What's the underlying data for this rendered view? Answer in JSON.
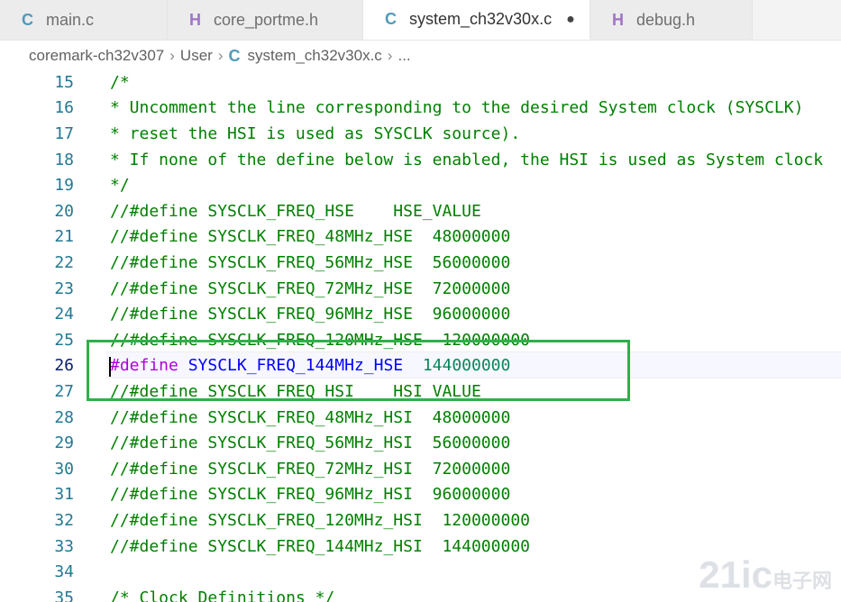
{
  "tabs": [
    {
      "icon": "C",
      "label": "main.c",
      "active": false,
      "modified": false
    },
    {
      "icon": "H",
      "label": "core_portme.h",
      "active": false,
      "modified": false
    },
    {
      "icon": "C",
      "label": "system_ch32v30x.c",
      "active": true,
      "modified": true
    },
    {
      "icon": "H",
      "label": "debug.h",
      "active": false,
      "modified": false
    }
  ],
  "breadcrumb": {
    "project": "coremark-ch32v307",
    "folder": "User",
    "file_icon": "C",
    "file": "system_ch32v30x.c",
    "more": "..."
  },
  "editor": {
    "current_line": 26,
    "lines": [
      {
        "n": "15",
        "text": "/*"
      },
      {
        "n": "16",
        "text": "* Uncomment the line corresponding to the desired System clock (SYSCLK)"
      },
      {
        "n": "17",
        "text": "* reset the HSI is used as SYSCLK source)."
      },
      {
        "n": "18",
        "text": "* If none of the define below is enabled, the HSI is used as System clock"
      },
      {
        "n": "19",
        "text": "*/"
      },
      {
        "n": "20",
        "text": "//#define SYSCLK_FREQ_HSE    HSE_VALUE"
      },
      {
        "n": "21",
        "text": "//#define SYSCLK_FREQ_48MHz_HSE  48000000"
      },
      {
        "n": "22",
        "text": "//#define SYSCLK_FREQ_56MHz_HSE  56000000"
      },
      {
        "n": "23",
        "text": "//#define SYSCLK_FREQ_72MHz_HSE  72000000"
      },
      {
        "n": "24",
        "text": "//#define SYSCLK_FREQ_96MHz_HSE  96000000"
      },
      {
        "n": "25",
        "text": "//#define SYSCLK_FREQ_120MHz_HSE  120000000"
      },
      {
        "n": "26",
        "keyword": "#define",
        "macro": "SYSCLK_FREQ_144MHz_HSE",
        "value": "144000000"
      },
      {
        "n": "27",
        "text": "//#define SYSCLK_FREQ_HSI    HSI_VALUE"
      },
      {
        "n": "28",
        "text": "//#define SYSCLK_FREQ_48MHz_HSI  48000000"
      },
      {
        "n": "29",
        "text": "//#define SYSCLK_FREQ_56MHz_HSI  56000000"
      },
      {
        "n": "30",
        "text": "//#define SYSCLK_FREQ_72MHz_HSI  72000000"
      },
      {
        "n": "31",
        "text": "//#define SYSCLK_FREQ_96MHz_HSI  96000000"
      },
      {
        "n": "32",
        "text": "//#define SYSCLK_FREQ_120MHz_HSI  120000000"
      },
      {
        "n": "33",
        "text": "//#define SYSCLK_FREQ_144MHz_HSI  144000000"
      },
      {
        "n": "34",
        "text": ""
      },
      {
        "n": "35",
        "text": "/* Clock Definitions */"
      }
    ]
  },
  "watermark": {
    "main": "21ic",
    "sub": "电子网"
  }
}
